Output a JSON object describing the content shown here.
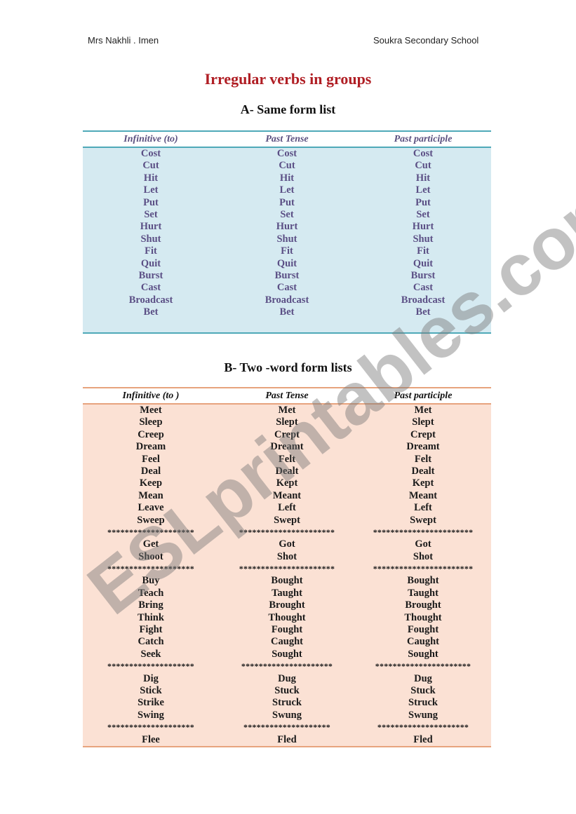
{
  "header": {
    "teacher": "Mrs Nakhli . Imen",
    "school": "Soukra  Secondary School"
  },
  "title": "Irregular  verbs in groups",
  "sectionA": {
    "title": "A- Same form list",
    "columns": [
      "Infinitive (to)",
      "Past Tense",
      "Past participle"
    ],
    "rows": [
      [
        "Cost",
        "Cost",
        "Cost"
      ],
      [
        "Cut",
        "Cut",
        "Cut"
      ],
      [
        "Hit",
        "Hit",
        "Hit"
      ],
      [
        "Let",
        "Let",
        "Let"
      ],
      [
        "Put",
        "Put",
        "Put"
      ],
      [
        "Set",
        "Set",
        "Set"
      ],
      [
        "Hurt",
        "Hurt",
        "Hurt"
      ],
      [
        "Shut",
        "Shut",
        "Shut"
      ],
      [
        "Fit",
        "Fit",
        "Fit"
      ],
      [
        "Quit",
        "Quit",
        "Quit"
      ],
      [
        "Burst",
        "Burst",
        "Burst"
      ],
      [
        "Cast",
        "Cast",
        "Cast"
      ],
      [
        "Broadcast",
        "Broadcast",
        "Broadcast"
      ],
      [
        "Bet",
        "Bet",
        "Bet"
      ]
    ]
  },
  "sectionB": {
    "title": "B- Two -word form lists",
    "columns": [
      "Infinitive (to )",
      "Past Tense",
      "Past participle"
    ],
    "rows": [
      [
        "Meet",
        "Met",
        "Met"
      ],
      [
        "Sleep",
        "Slept",
        "Slept"
      ],
      [
        "Creep",
        "Crept",
        "Crept"
      ],
      [
        "Dream",
        "Dreamt",
        "Dreamt"
      ],
      [
        "Feel",
        "Felt",
        "Felt"
      ],
      [
        "Deal",
        "Dealt",
        "Dealt"
      ],
      [
        "Keep",
        "Kept",
        "Kept"
      ],
      [
        "Mean",
        "Meant",
        "Meant"
      ],
      [
        "Leave",
        "Left",
        "Left"
      ],
      [
        "Sweep",
        "Swept",
        "Swept"
      ],
      [
        "********************",
        "**********************",
        "***********************"
      ],
      [
        "Get",
        "Got",
        "Got"
      ],
      [
        "Shoot",
        "Shot",
        "Shot"
      ],
      [
        "********************",
        "**********************",
        "***********************"
      ],
      [
        "Buy",
        "Bought",
        "Bought"
      ],
      [
        "Teach",
        "Taught",
        "Taught"
      ],
      [
        "Bring",
        "Brought",
        "Brought"
      ],
      [
        "Think",
        "Thought",
        "Thought"
      ],
      [
        "Fight",
        "Fought",
        "Fought"
      ],
      [
        "Catch",
        "Caught",
        "Caught"
      ],
      [
        "Seek",
        "Sought",
        "Sought"
      ],
      [
        "********************",
        "*********************",
        "**********************"
      ],
      [
        "Dig",
        "Dug",
        "Dug"
      ],
      [
        "Stick",
        "Stuck",
        "Stuck"
      ],
      [
        "Strike",
        "Struck",
        "Struck"
      ],
      [
        "Swing",
        "Swung",
        "Swung"
      ],
      [
        "********************",
        "********************",
        "*********************"
      ],
      [
        "Flee",
        "Fled",
        "Fled"
      ]
    ]
  },
  "watermark": "ESLprintables.com"
}
